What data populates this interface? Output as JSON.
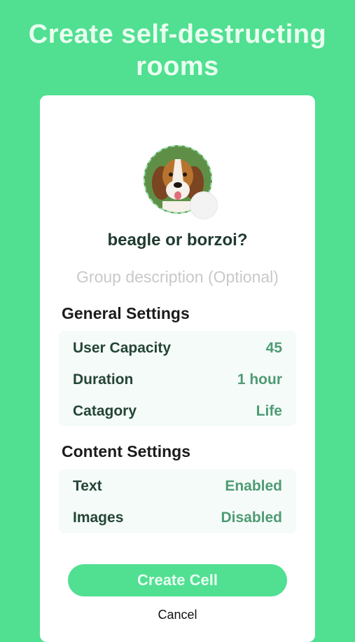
{
  "headline": [
    "Create self-destructing",
    "rooms"
  ],
  "room": {
    "name": "beagle or borzoi?",
    "description_placeholder": "Group description (Optional)"
  },
  "general_settings": {
    "title": "General Settings",
    "rows": [
      {
        "label": "User Capacity",
        "value": "45"
      },
      {
        "label": "Duration",
        "value": "1 hour"
      },
      {
        "label": "Catagory",
        "value": "Life"
      }
    ]
  },
  "content_settings": {
    "title": "Content Settings",
    "rows": [
      {
        "label": "Text",
        "value": "Enabled"
      },
      {
        "label": "Images",
        "value": "Disabled"
      }
    ]
  },
  "actions": {
    "create_label": "Create Cell",
    "cancel_label": "Cancel"
  },
  "colors": {
    "background": "#51df92",
    "accent_value": "#4e9b74",
    "panel": "#f5fbf8"
  }
}
